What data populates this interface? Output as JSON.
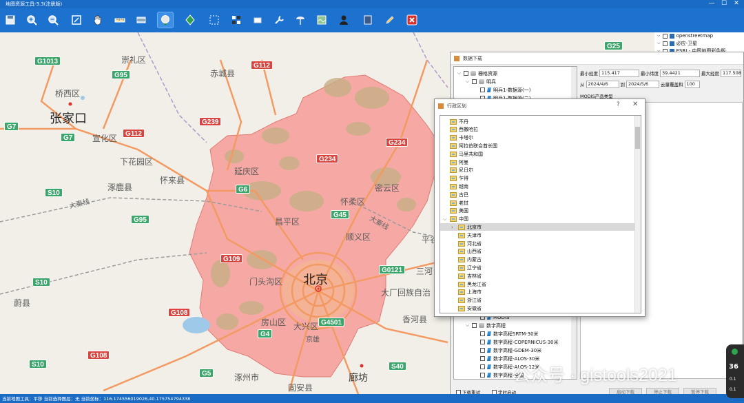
{
  "app": {
    "title": "地图资源工具-3.3(注册版)",
    "window_controls": [
      "—",
      "☐",
      "✕"
    ]
  },
  "toolbar": {
    "buttons": [
      {
        "icon": "save-icon"
      },
      {
        "icon": "zoom-in-icon"
      },
      {
        "icon": "zoom-out-icon"
      },
      {
        "icon": "full-extent-icon"
      },
      {
        "icon": "pan-hand-icon"
      },
      {
        "icon": "ruler-icon"
      },
      {
        "icon": "area-measure-icon"
      },
      {
        "icon": "globe-download-icon",
        "active": true
      },
      {
        "icon": "layer-diamond-icon"
      },
      {
        "icon": "select-area-icon"
      },
      {
        "icon": "grid-icon"
      },
      {
        "icon": "eraser-icon"
      },
      {
        "icon": "wrench-icon"
      },
      {
        "icon": "satellite-icon"
      },
      {
        "icon": "map-image-icon"
      },
      {
        "icon": "user-icon"
      },
      {
        "icon": "book-icon"
      },
      {
        "icon": "pencil-icon"
      },
      {
        "icon": "close-red-icon"
      }
    ]
  },
  "map": {
    "colors": {
      "land": "#f1efe7",
      "beijing_fill": "#f6a9a4",
      "beijing_border": "#e07a74",
      "hills": "#c7ae86",
      "road": "#f39a63"
    },
    "shields": [
      {
        "text": "G1013",
        "type": "g"
      },
      {
        "text": "G95",
        "type": "g"
      },
      {
        "text": "G112",
        "type": "r"
      },
      {
        "text": "G25",
        "type": "g"
      },
      {
        "text": "G7",
        "type": "g"
      },
      {
        "text": "G7",
        "type": "g"
      },
      {
        "text": "G112",
        "type": "r"
      },
      {
        "text": "G239",
        "type": "r"
      },
      {
        "text": "G234",
        "type": "r"
      },
      {
        "text": "G234",
        "type": "r"
      },
      {
        "text": "G6",
        "type": "g"
      },
      {
        "text": "S10",
        "type": "g"
      },
      {
        "text": "G95",
        "type": "g"
      },
      {
        "text": "G45",
        "type": "g"
      },
      {
        "text": "G109",
        "type": "r"
      },
      {
        "text": "S10",
        "type": "g"
      },
      {
        "text": "G0121",
        "type": "g"
      },
      {
        "text": "G108",
        "type": "r"
      },
      {
        "text": "G4501",
        "type": "g"
      },
      {
        "text": "G4",
        "type": "g"
      },
      {
        "text": "G108",
        "type": "r"
      },
      {
        "text": "S10",
        "type": "g"
      },
      {
        "text": "G5",
        "type": "g"
      },
      {
        "text": "S40",
        "type": "g"
      }
    ],
    "places": [
      {
        "text": "崇礼区",
        "size": "normal"
      },
      {
        "text": "赤城县",
        "size": "normal"
      },
      {
        "text": "桥西区",
        "size": "normal"
      },
      {
        "text": "张家口",
        "size": "big"
      },
      {
        "text": "宣化区",
        "size": "normal"
      },
      {
        "text": "下花园区",
        "size": "normal"
      },
      {
        "text": "延庆区",
        "size": "normal"
      },
      {
        "text": "怀来县",
        "size": "normal"
      },
      {
        "text": "涿鹿县",
        "size": "normal"
      },
      {
        "text": "密云区",
        "size": "normal"
      },
      {
        "text": "怀柔区",
        "size": "normal"
      },
      {
        "text": "昌平区",
        "size": "normal"
      },
      {
        "text": "顺义区",
        "size": "normal"
      },
      {
        "text": "平谷",
        "size": "normal"
      },
      {
        "text": "门头沟区",
        "size": "normal"
      },
      {
        "text": "北京",
        "size": "big"
      },
      {
        "text": "三河",
        "size": "normal"
      },
      {
        "text": "大厂回族自治",
        "size": "normal"
      },
      {
        "text": "蔚县",
        "size": "normal"
      },
      {
        "text": "房山区",
        "size": "normal"
      },
      {
        "text": "大兴区",
        "size": "normal"
      },
      {
        "text": "香河县",
        "size": "normal"
      },
      {
        "text": "涿州市",
        "size": "normal"
      },
      {
        "text": "廊坊",
        "size": "med"
      },
      {
        "text": "固安县",
        "size": "normal"
      },
      {
        "text": "京雄",
        "size": "normal"
      }
    ],
    "rails": [
      {
        "text": "大秦线"
      },
      {
        "text": "大秦线"
      }
    ]
  },
  "layerlist": {
    "items": [
      {
        "label": "openstreetmap"
      },
      {
        "label": "必应-卫星"
      },
      {
        "label": "ESRI - 中国地图彩色版"
      }
    ]
  },
  "download_panel": {
    "title": "数据下载",
    "tree_top": [
      {
        "label": "栅格资源",
        "level": 0,
        "expander": "⌵"
      },
      {
        "label": "明兵",
        "level": 1,
        "expander": "⌵"
      },
      {
        "label": "明兵1-数据源(一)",
        "level": 2
      },
      {
        "label": "明兵1-数据源(二)",
        "level": 2
      }
    ],
    "tree_bottom": [
      {
        "label": "MODIS",
        "level": 2
      },
      {
        "label": "数字高程",
        "level": 1,
        "expander": "⌵"
      },
      {
        "label": "数字高程SRTM-30米",
        "level": 2
      },
      {
        "label": "数字高程-COPERNICUS-30米",
        "level": 2
      },
      {
        "label": "数字高程-GDEM-30米",
        "level": 2
      },
      {
        "label": "数字高程-ALOS-30米",
        "level": 2
      },
      {
        "label": "数字高程-ALOS-12米",
        "level": 2
      },
      {
        "label": "数字高程-全国",
        "level": 2
      }
    ],
    "form": {
      "min_lon_label": "最小经度",
      "min_lon_value": "115.417",
      "min_lat_label": "最小纬度",
      "min_lat_value": "39.4421",
      "max_lon_label": "最大经度",
      "max_lon_value": "117.508",
      "from_label": "从",
      "from_value": "2024/4/6",
      "to_label": "到",
      "to_value": "2024/5/6",
      "cloud_label": "云量覆盖和",
      "cloud_value": "100",
      "product_type_label": "MODIS产品类型"
    },
    "checkbox_retry": "下载重试",
    "checkbox_timer": "定时启动",
    "buttons": [
      "启动下载",
      "停止下载",
      "暂停下载"
    ]
  },
  "region_dialog": {
    "title": "行政区划",
    "help": "?",
    "close": "✕",
    "items": [
      {
        "label": "不丹",
        "level": 0
      },
      {
        "label": "西撒哈拉",
        "level": 0
      },
      {
        "label": "卡塔尔",
        "level": 0
      },
      {
        "label": "阿拉伯联合酋长国",
        "level": 0
      },
      {
        "label": "马里共和国",
        "level": 0
      },
      {
        "label": "阿曼",
        "level": 0
      },
      {
        "label": "尼日尔",
        "level": 0
      },
      {
        "label": "乍得",
        "level": 0
      },
      {
        "label": "越南",
        "level": 0
      },
      {
        "label": "古巴",
        "level": 0
      },
      {
        "label": "老挝",
        "level": 0
      },
      {
        "label": "美国",
        "level": 0
      },
      {
        "label": "中国",
        "level": 0,
        "expander": "⌵"
      },
      {
        "label": "北京市",
        "level": 1,
        "expander": "›",
        "selected": true
      },
      {
        "label": "天津市",
        "level": 1
      },
      {
        "label": "河北省",
        "level": 1
      },
      {
        "label": "山西省",
        "level": 1
      },
      {
        "label": "内蒙古",
        "level": 1
      },
      {
        "label": "辽宁省",
        "level": 1
      },
      {
        "label": "吉林省",
        "level": 1
      },
      {
        "label": "黑龙江省",
        "level": 1
      },
      {
        "label": "上海市",
        "level": 1
      },
      {
        "label": "浙江省",
        "level": 1
      },
      {
        "label": "安徽省",
        "level": 1
      }
    ]
  },
  "statusbar": {
    "text": "当前地图工具：平移  当前选择图层：无  当前坐标：116.174556019026,40.175754794338"
  },
  "watermark": "公众号 · gistools2021",
  "speed_widget": {
    "value": "36",
    "up": "0.1",
    "down": "0.1"
  }
}
